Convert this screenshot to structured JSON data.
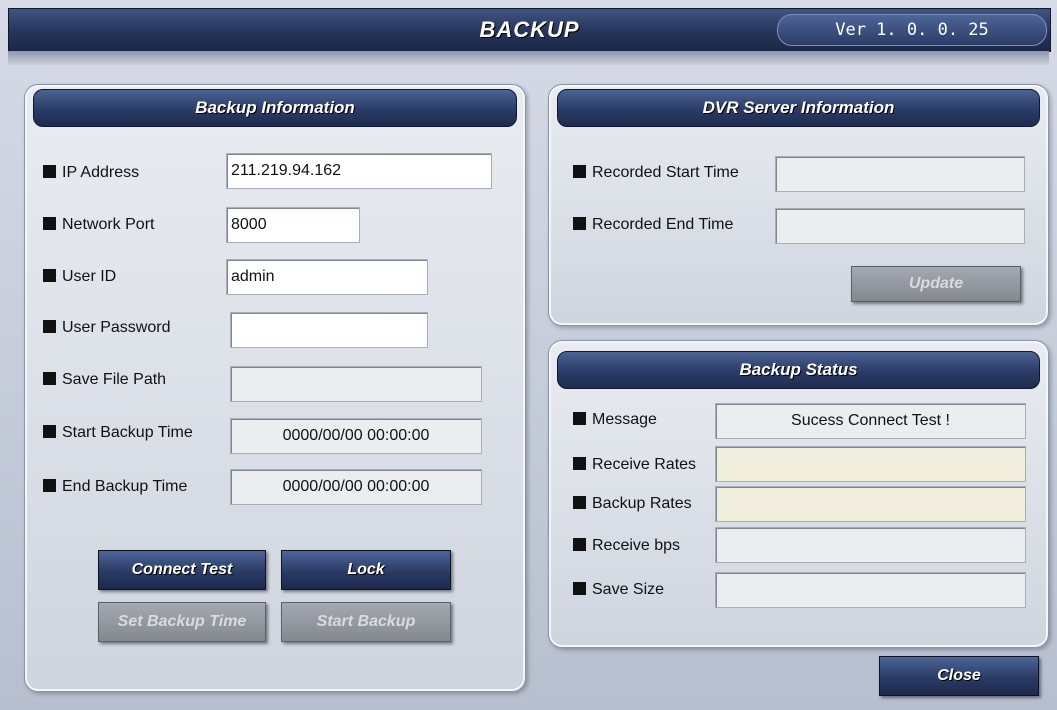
{
  "window": {
    "title": "BACKUP",
    "version": "Ver 1. 0. 0. 25"
  },
  "backup_info": {
    "heading": "Backup Information",
    "ip_label": "IP Address",
    "ip_value": "211.219.94.162",
    "port_label": "Network Port",
    "port_value": "8000",
    "userid_label": "User ID",
    "userid_value": "admin",
    "password_label": "User Password",
    "password_value": "",
    "savepath_label": "Save File Path",
    "savepath_value": "",
    "start_label": "Start Backup Time",
    "start_value": "0000/00/00 00:00:00",
    "end_label": "End Backup Time",
    "end_value": "0000/00/00 00:00:00",
    "buttons": {
      "connect_test": "Connect Test",
      "lock": "Lock",
      "set_backup_time": "Set Backup Time",
      "start_backup": "Start Backup"
    }
  },
  "dvr_info": {
    "heading": "DVR Server Information",
    "rec_start_label": "Recorded Start Time",
    "rec_start_value": "",
    "rec_end_label": "Recorded End Time",
    "rec_end_value": "",
    "update_button": "Update"
  },
  "backup_status": {
    "heading": "Backup Status",
    "message_label": "Message",
    "message_value": "Sucess Connect Test !",
    "receive_rates_label": "Receive Rates",
    "receive_rates_value": "",
    "backup_rates_label": "Backup Rates",
    "backup_rates_value": "",
    "receive_bps_label": "Receive bps",
    "receive_bps_value": "",
    "save_size_label": "Save Size",
    "save_size_value": ""
  },
  "footer": {
    "close_button": "Close"
  },
  "colors": {
    "header_blue": "#2a3b66",
    "disabled_gray": "#84888f",
    "beige_field": "#f2eede"
  }
}
